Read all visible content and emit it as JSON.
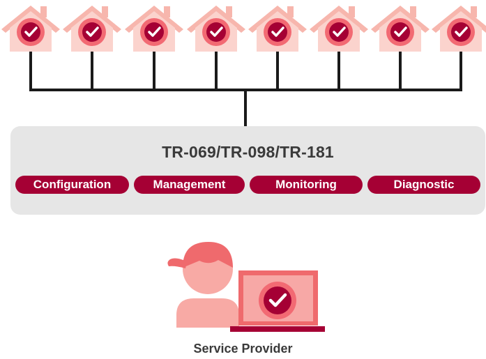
{
  "diagram": {
    "protocols": "TR-069/TR-098/TR-181",
    "functions": [
      "Configuration",
      "Management",
      "Monitoring",
      "Diagnostic"
    ],
    "provider_label": "Service Provider",
    "home_count": 8,
    "colors": {
      "house_body": "#fbd3cd",
      "house_roof": "#f7b6ad",
      "check_outer": "#f26a73",
      "check_inner": "#a50034",
      "bus_line": "#1a1a1a",
      "panel_bg": "#e6e6e6",
      "pill_bg": "#a50034",
      "person": "#f8aaa5",
      "hair": "#ef6a6d",
      "laptop": "#ef6a6d"
    }
  }
}
